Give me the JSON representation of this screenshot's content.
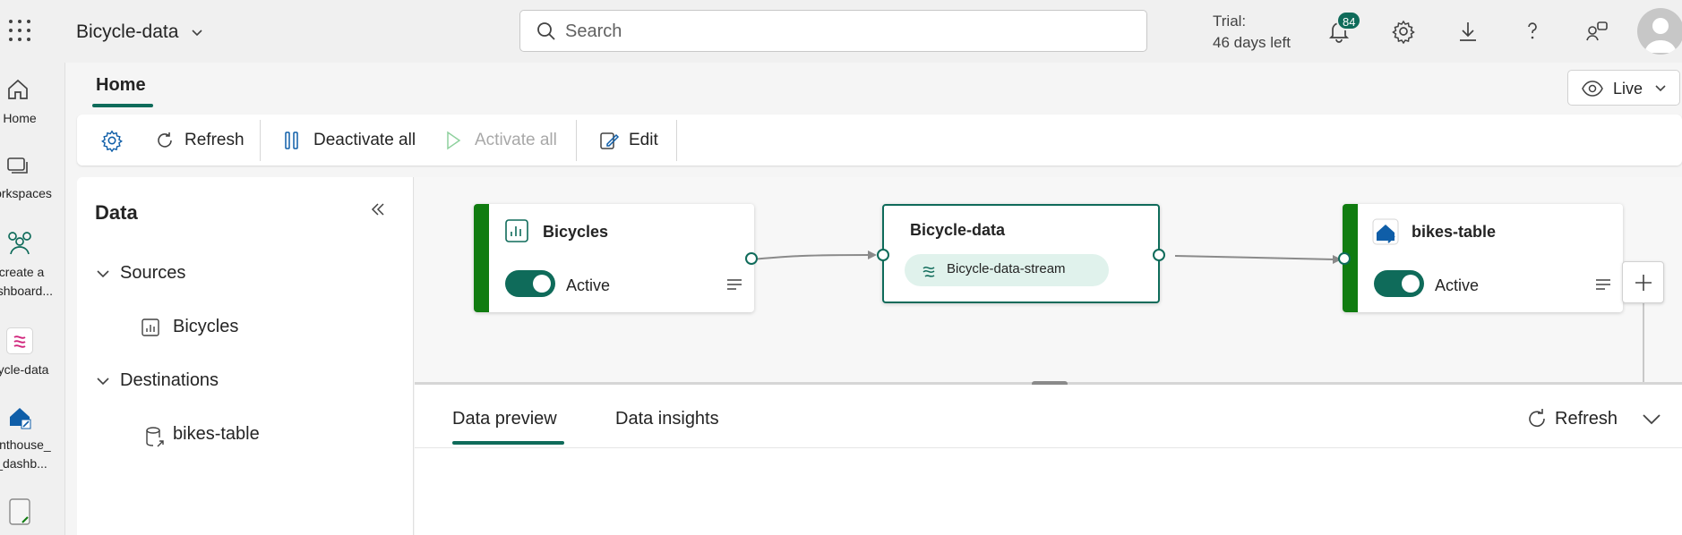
{
  "topbar": {
    "app_title": "Bicycle-data",
    "search_placeholder": "Search",
    "trial_line1": "Trial:",
    "trial_line2": "46 days left",
    "notification_count": "84"
  },
  "rail": {
    "items": [
      {
        "label": "Home",
        "icon": "home-icon"
      },
      {
        "label": "orkspaces",
        "icon": "workspaces-icon"
      },
      {
        "label": "create a",
        "label2": "ashboard...",
        "icon": "create-dashboard-icon"
      },
      {
        "label": "ycle-data",
        "icon": "eventstream-icon"
      },
      {
        "label": "enthouse_",
        "label2": "_dashb...",
        "icon": "eventhouse-icon"
      },
      {
        "label": "",
        "icon": "item-icon"
      }
    ]
  },
  "header": {
    "home_tab": "Home",
    "live_label": "Live"
  },
  "toolbar": {
    "refresh_label": "Refresh",
    "deactivate_all_label": "Deactivate all",
    "activate_all_label": "Activate all",
    "edit_label": "Edit"
  },
  "data_panel": {
    "title": "Data",
    "sources_label": "Sources",
    "sources": [
      "Bicycles"
    ],
    "destinations_label": "Destinations",
    "destinations": [
      "bikes-table"
    ]
  },
  "canvas": {
    "source_node": {
      "title": "Bicycles",
      "status": "Active"
    },
    "stream_node": {
      "title": "Bicycle-data",
      "stream": "Bicycle-data-stream"
    },
    "destination_node": {
      "title": "bikes-table",
      "status": "Active"
    }
  },
  "bottom": {
    "tabs": [
      "Data preview",
      "Data insights"
    ],
    "refresh_label": "Refresh"
  },
  "colors": {
    "accent": "#0f6b5a",
    "active_bar": "#107c10"
  }
}
